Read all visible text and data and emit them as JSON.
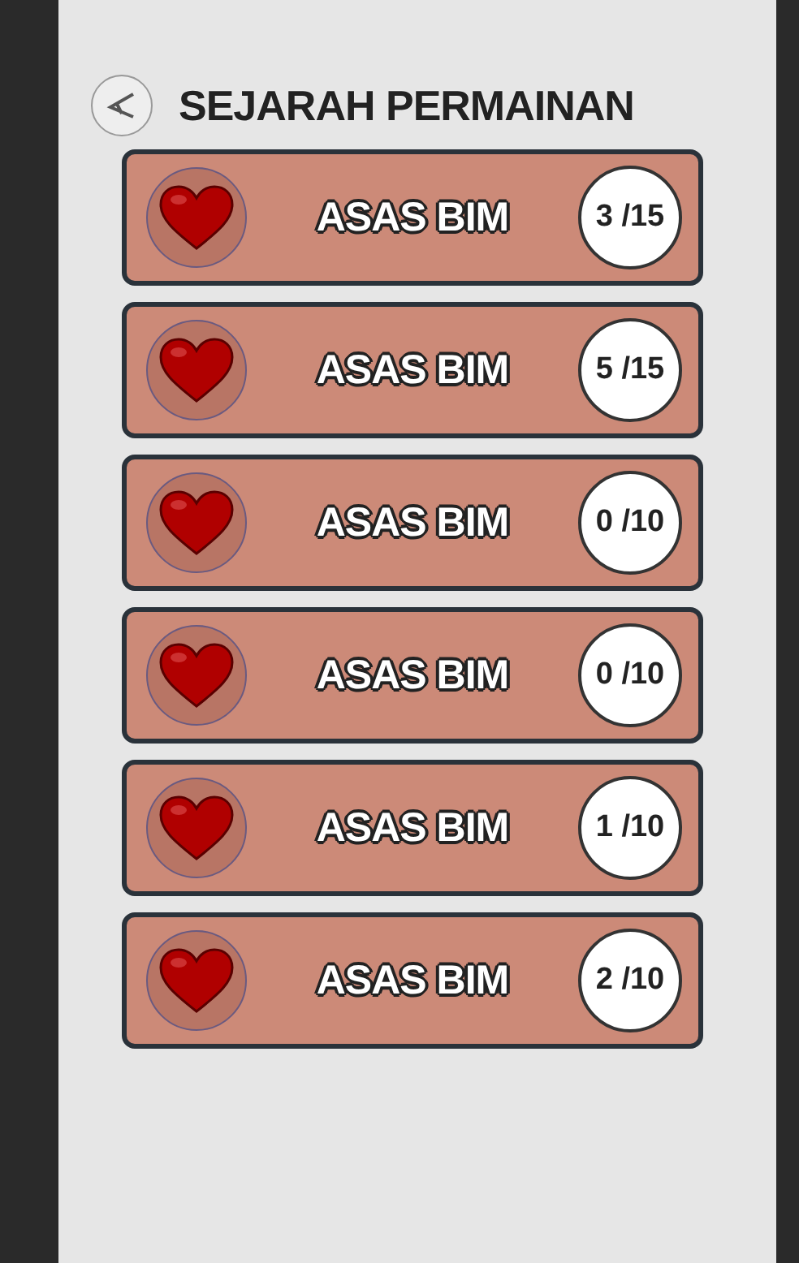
{
  "header": {
    "title": "SEJARAH PERMAINAN"
  },
  "games": [
    {
      "name": "ASAS BIM",
      "score": "3 /15"
    },
    {
      "name": "ASAS BIM",
      "score": "5 /15"
    },
    {
      "name": "ASAS BIM",
      "score": "0 /10"
    },
    {
      "name": "ASAS BIM",
      "score": "0 /10"
    },
    {
      "name": "ASAS BIM",
      "score": "1 /10"
    },
    {
      "name": "ASAS BIM",
      "score": "2 /10"
    }
  ]
}
